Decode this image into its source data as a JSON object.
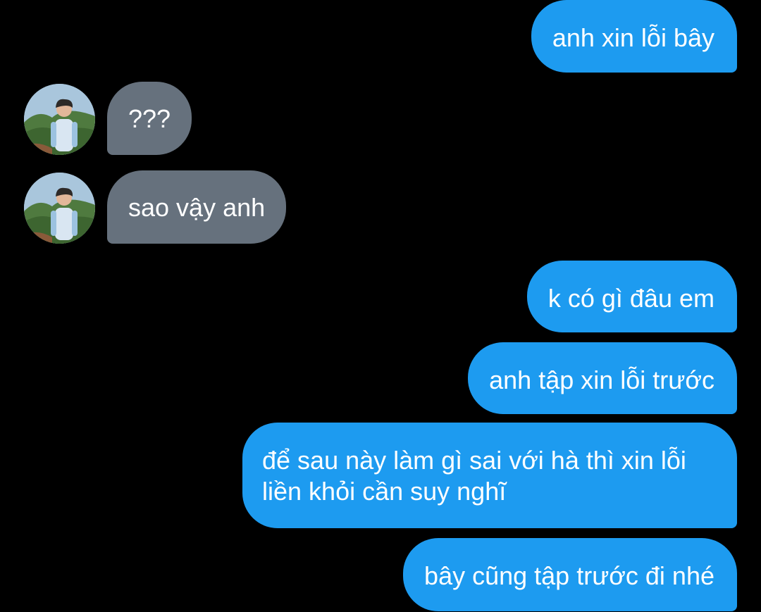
{
  "colors": {
    "background": "#000000",
    "sent_bubble": "#1d9bf0",
    "received_bubble": "#66717d",
    "text": "#ffffff"
  },
  "conversation": {
    "messages": [
      {
        "direction": "sent",
        "text": "anh xin lỗi bây"
      },
      {
        "direction": "received",
        "text": "???"
      },
      {
        "direction": "received",
        "text": "sao vậy anh"
      },
      {
        "direction": "sent",
        "text": "k có gì đâu em"
      },
      {
        "direction": "sent",
        "text": "anh tập xin lỗi trước"
      },
      {
        "direction": "sent",
        "text": "để sau này làm gì sai với hà thì xin lỗi liền khỏi cần suy nghĩ"
      },
      {
        "direction": "sent",
        "text": "bây cũng tập trước đi nhé"
      }
    ],
    "avatar_icon": "contact-photo"
  }
}
